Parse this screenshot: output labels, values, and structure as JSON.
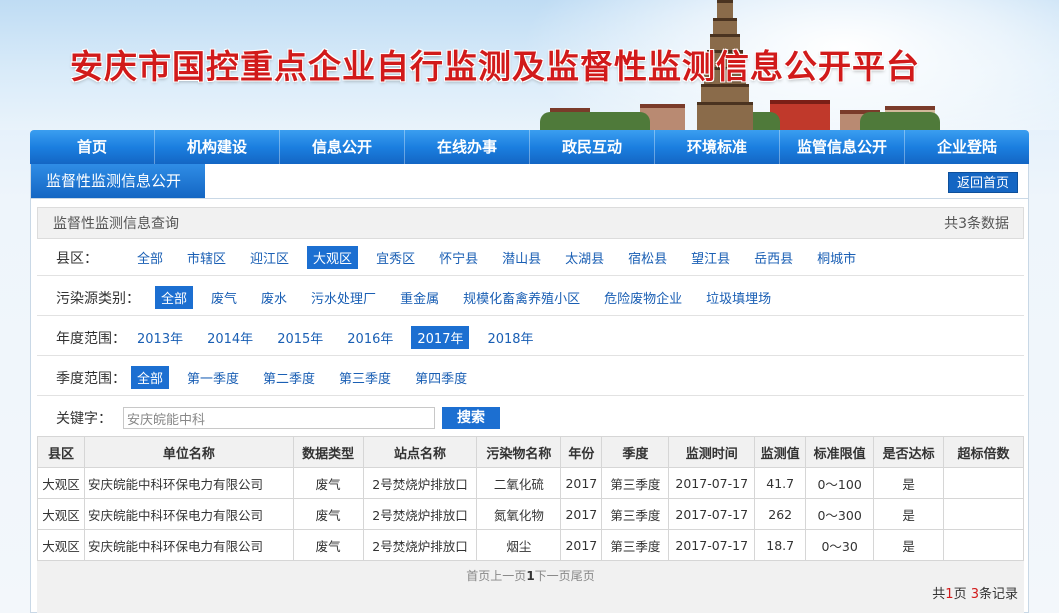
{
  "header": {
    "title": "安庆市国控重点企业自行监测及监督性监测信息公开平台"
  },
  "nav": [
    "首页",
    "机构建设",
    "信息公开",
    "在线办事",
    "政民互动",
    "环境标准",
    "监管信息公开",
    "企业登陆"
  ],
  "section": {
    "tab": "监督性监测信息公开",
    "home_button": "返回首页"
  },
  "query": {
    "title": "监督性监测信息查询",
    "count": "共3条数据"
  },
  "filters": {
    "district": {
      "label": "县区：",
      "options": [
        "全部",
        "市辖区",
        "迎江区",
        "大观区",
        "宜秀区",
        "怀宁县",
        "潜山县",
        "太湖县",
        "宿松县",
        "望江县",
        "岳西县",
        "桐城市"
      ],
      "active": 3
    },
    "source": {
      "label": "污染源类别：",
      "options": [
        "全部",
        "废气",
        "废水",
        "污水处理厂",
        "重金属",
        "规模化畜禽养殖小区",
        "危险废物企业",
        "垃圾填埋场"
      ],
      "active": 0
    },
    "year": {
      "label": "年度范围：",
      "options": [
        "2013年",
        "2014年",
        "2015年",
        "2016年",
        "2017年",
        "2018年"
      ],
      "active": 4
    },
    "season": {
      "label": "季度范围：",
      "options": [
        "全部",
        "第一季度",
        "第二季度",
        "第三季度",
        "第四季度"
      ],
      "active": 0
    }
  },
  "keyword": {
    "label": "关键字：",
    "value": "安庆皖能中科",
    "button": "搜索"
  },
  "table": {
    "headers": [
      "县区",
      "单位名称",
      "数据类型",
      "站点名称",
      "污染物名称",
      "年份",
      "季度",
      "监测时间",
      "监测值",
      "标准限值",
      "是否达标",
      "超标倍数"
    ],
    "rows": [
      [
        "大观区",
        "安庆皖能中科环保电力有限公司",
        "废气",
        "2号焚烧炉排放口",
        "二氧化硫",
        "2017",
        "第三季度",
        "2017-07-17",
        "41.7",
        "0～100",
        "是",
        ""
      ],
      [
        "大观区",
        "安庆皖能中科环保电力有限公司",
        "废气",
        "2号焚烧炉排放口",
        "氮氧化物",
        "2017",
        "第三季度",
        "2017-07-17",
        "262",
        "0～300",
        "是",
        ""
      ],
      [
        "大观区",
        "安庆皖能中科环保电力有限公司",
        "废气",
        "2号焚烧炉排放口",
        "烟尘",
        "2017",
        "第三季度",
        "2017-07-17",
        "18.7",
        "0～30",
        "是",
        ""
      ]
    ]
  },
  "pager": {
    "first": "首页",
    "prev": "上一页",
    "current": "1",
    "next": "下一页",
    "last": "尾页",
    "total_prefix": "共",
    "total_pages": "1",
    "pages_mid": "页 ",
    "total_records": "3",
    "records_suffix": "条记录"
  }
}
